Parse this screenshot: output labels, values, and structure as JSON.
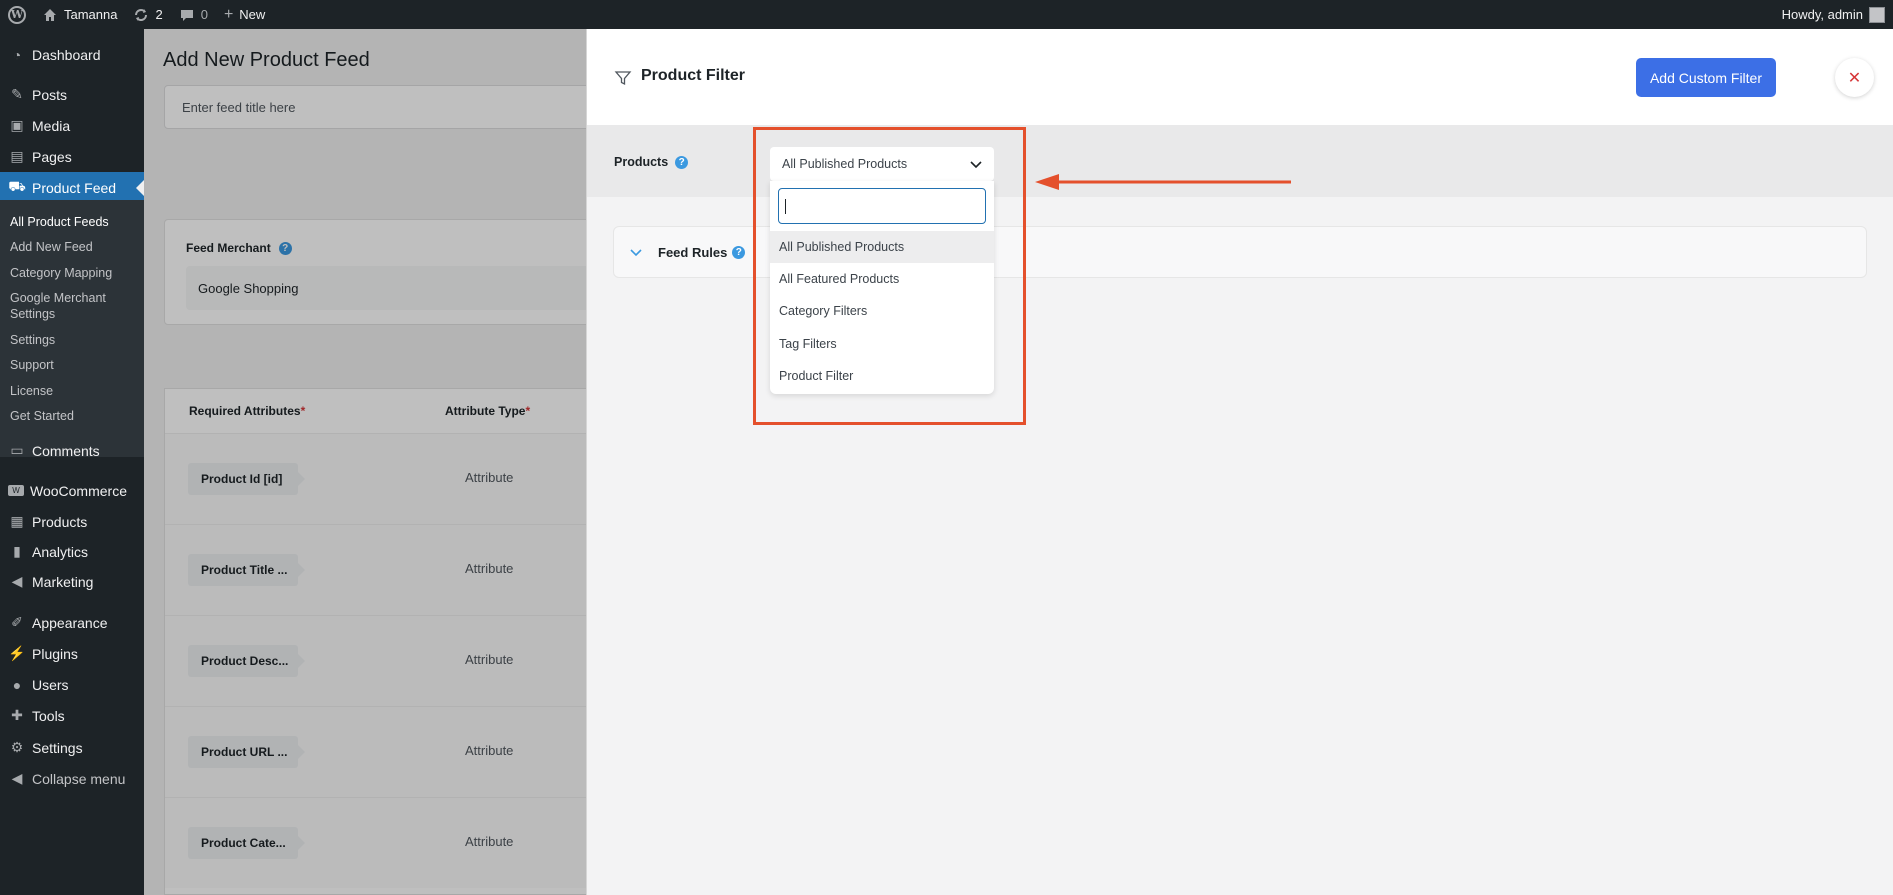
{
  "adminbar": {
    "site_name": "Tamanna",
    "updates_count": "2",
    "comments_count": "0",
    "new_label": "New",
    "howdy": "Howdy, admin"
  },
  "sidebar": {
    "items": [
      {
        "label": "Dashboard",
        "icon": "dashboard-icon"
      },
      {
        "label": "Posts",
        "icon": "pin-icon"
      },
      {
        "label": "Media",
        "icon": "media-icon"
      },
      {
        "label": "Pages",
        "icon": "pages-icon"
      },
      {
        "label": "Product Feed",
        "icon": "cart-icon"
      },
      {
        "label": "Comments",
        "icon": "comment-icon"
      },
      {
        "label": "WooCommerce",
        "icon": "woo-icon"
      },
      {
        "label": "Products",
        "icon": "archive-icon"
      },
      {
        "label": "Analytics",
        "icon": "bar-chart-icon"
      },
      {
        "label": "Marketing",
        "icon": "megaphone-icon"
      },
      {
        "label": "Appearance",
        "icon": "brush-icon"
      },
      {
        "label": "Plugins",
        "icon": "plug-icon"
      },
      {
        "label": "Users",
        "icon": "user-icon"
      },
      {
        "label": "Tools",
        "icon": "wrench-icon"
      },
      {
        "label": "Settings",
        "icon": "settings-icon"
      },
      {
        "label": "Collapse menu",
        "icon": "collapse-icon"
      }
    ],
    "submenu": [
      "All Product Feeds",
      "Add New Feed",
      "Category Mapping",
      "Google Merchant Settings",
      "Settings",
      "Support",
      "License",
      "Get Started"
    ]
  },
  "main": {
    "page_title": "Add New Product Feed",
    "title_placeholder": "Enter feed title here",
    "merchant_label": "Feed Merchant",
    "merchant_value": "Google Shopping",
    "attr_header_required": "Required Attributes",
    "attr_header_type": "Attribute Type",
    "required_mark": "*",
    "attributes": [
      {
        "name": "Product Id [id]",
        "type": "Attribute"
      },
      {
        "name": "Product Title ...",
        "type": "Attribute"
      },
      {
        "name": "Product Desc...",
        "type": "Attribute"
      },
      {
        "name": "Product URL ...",
        "type": "Attribute"
      },
      {
        "name": "Product Cate...",
        "type": "Attribute"
      }
    ]
  },
  "drawer": {
    "title": "Product Filter",
    "add_custom_filter": "Add Custom Filter",
    "products_label": "Products",
    "selected_value": "All Published Products",
    "search_value": "",
    "options": [
      "All Published Products",
      "All Featured Products",
      "Category Filters",
      "Tag Filters",
      "Product Filter"
    ],
    "feed_rules_label": "Feed Rules"
  },
  "colors": {
    "accent": "#3c6fe6",
    "annotation": "#e4502c",
    "admin_dark": "#1d2327",
    "active_menu": "#2271b1"
  }
}
